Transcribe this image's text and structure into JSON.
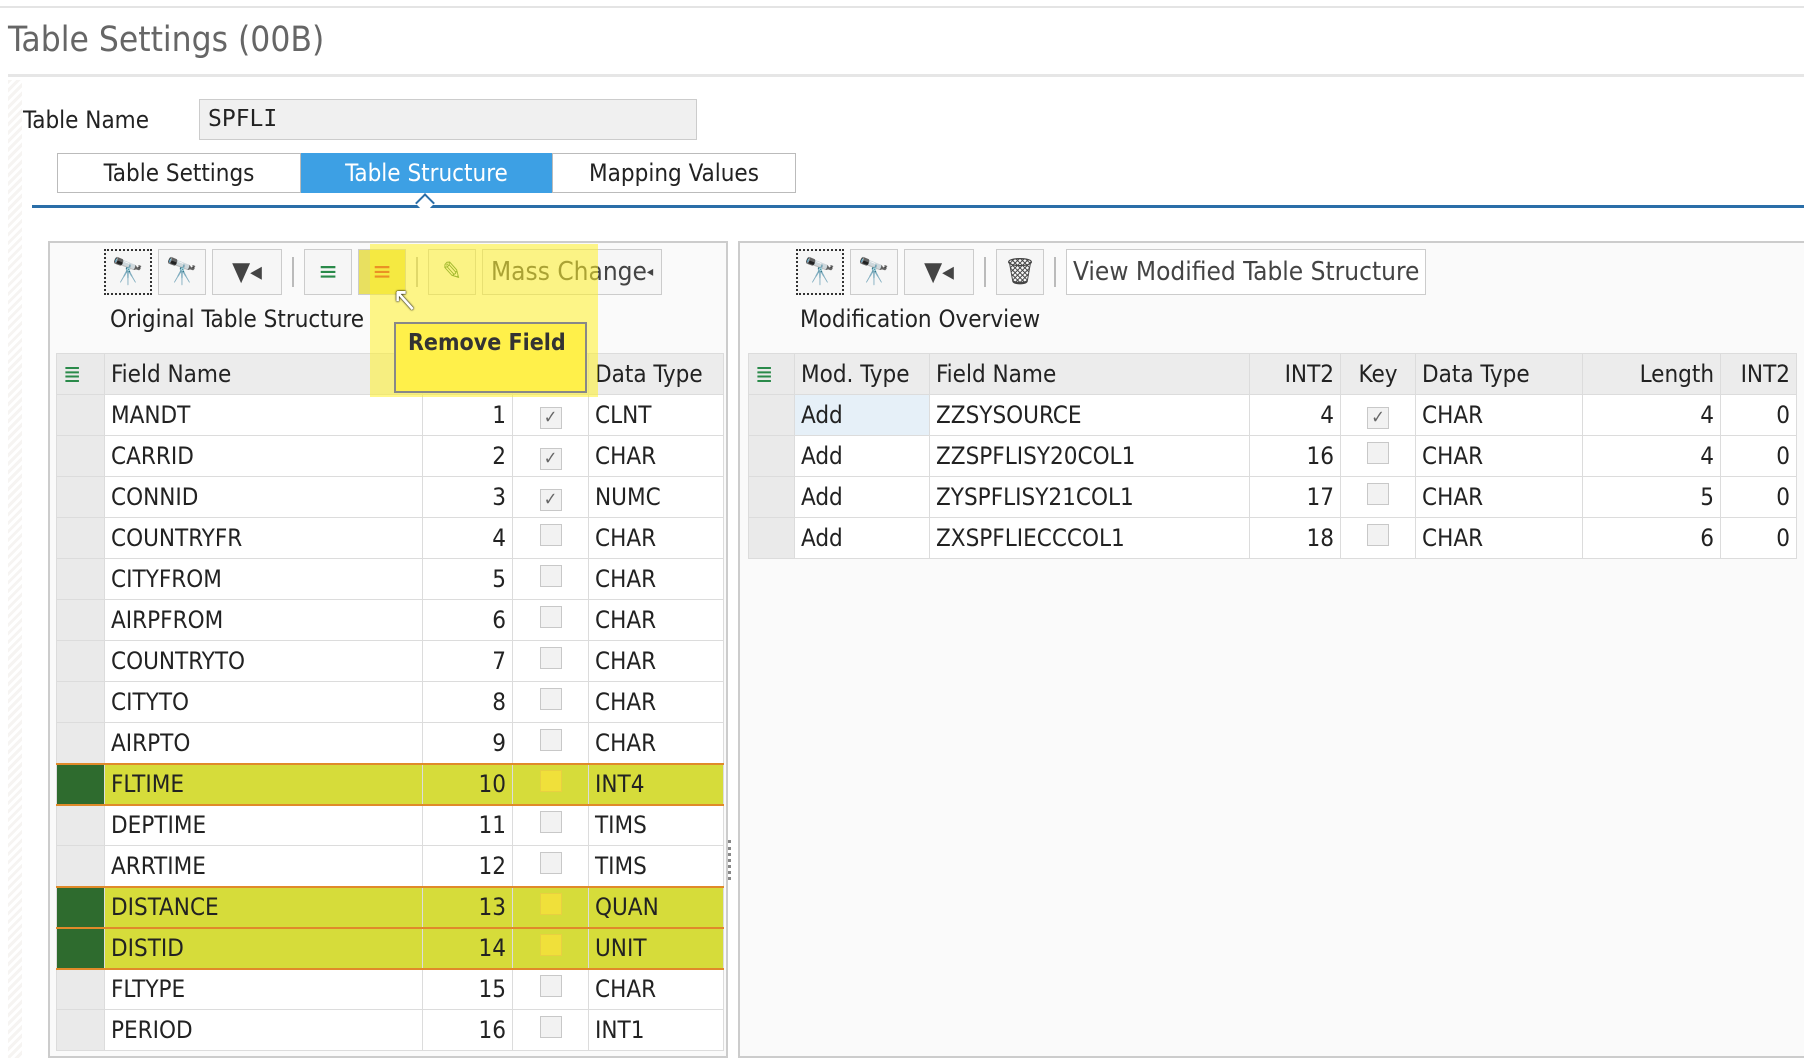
{
  "window": {
    "title": "Table Settings (00B)"
  },
  "table_name": {
    "label": "Table Name",
    "value": "SPFLI"
  },
  "tabs": [
    {
      "label": "Table Settings",
      "active": false
    },
    {
      "label": "Table Structure",
      "active": true
    },
    {
      "label": "Mapping Values",
      "active": false
    }
  ],
  "left": {
    "toolbar": {
      "find_icon": "binoculars-icon",
      "find_next_icon": "binoculars-plus-icon",
      "filter_icon": "filter-icon",
      "add_field_icon": "add-field-icon",
      "remove_field_icon": "remove-field-icon",
      "edit_icon": "pencil-icon",
      "mass_change": "Mass Change"
    },
    "title": "Original Table Structure",
    "tooltip": "Remove Field",
    "columns": [
      "Field Name",
      "",
      "",
      "Data Type"
    ],
    "rows": [
      {
        "name": "MANDT",
        "pos": "1",
        "key": true,
        "type": "CLNT"
      },
      {
        "name": "CARRID",
        "pos": "2",
        "key": true,
        "type": "CHAR"
      },
      {
        "name": "CONNID",
        "pos": "3",
        "key": true,
        "type": "NUMC"
      },
      {
        "name": "COUNTRYFR",
        "pos": "4",
        "key": false,
        "type": "CHAR"
      },
      {
        "name": "CITYFROM",
        "pos": "5",
        "key": false,
        "type": "CHAR"
      },
      {
        "name": "AIRPFROM",
        "pos": "6",
        "key": false,
        "type": "CHAR"
      },
      {
        "name": "COUNTRYTO",
        "pos": "7",
        "key": false,
        "type": "CHAR"
      },
      {
        "name": "CITYTO",
        "pos": "8",
        "key": false,
        "type": "CHAR"
      },
      {
        "name": "AIRPTO",
        "pos": "9",
        "key": false,
        "type": "CHAR"
      },
      {
        "name": "FLTIME",
        "pos": "10",
        "key": false,
        "type": "INT4",
        "selected": true
      },
      {
        "name": "DEPTIME",
        "pos": "11",
        "key": false,
        "type": "TIMS"
      },
      {
        "name": "ARRTIME",
        "pos": "12",
        "key": false,
        "type": "TIMS"
      },
      {
        "name": "DISTANCE",
        "pos": "13",
        "key": false,
        "type": "QUAN",
        "selected": true
      },
      {
        "name": "DISTID",
        "pos": "14",
        "key": false,
        "type": "UNIT",
        "selected": true
      },
      {
        "name": "FLTYPE",
        "pos": "15",
        "key": false,
        "type": "CHAR"
      },
      {
        "name": "PERIOD",
        "pos": "16",
        "key": false,
        "type": "INT1"
      }
    ]
  },
  "right": {
    "toolbar": {
      "find_icon": "binoculars-icon",
      "find_next_icon": "binoculars-plus-icon",
      "filter_icon": "filter-icon",
      "delete_icon": "trash-icon",
      "view_button": "View Modified Table Structure"
    },
    "title": "Modification Overview",
    "columns": [
      "Mod. Type",
      "Field Name",
      "INT2",
      "Key",
      "Data Type",
      "Length",
      "INT2"
    ],
    "rows": [
      {
        "mod": "Add",
        "name": "ZZSYSOURCE",
        "int2": "4",
        "key": true,
        "type": "CHAR",
        "length": "4",
        "int2b": "0"
      },
      {
        "mod": "Add",
        "name": "ZZSPFLISY20COL1",
        "int2": "16",
        "key": false,
        "type": "CHAR",
        "length": "4",
        "int2b": "0"
      },
      {
        "mod": "Add",
        "name": "ZYSPFLISY21COL1",
        "int2": "17",
        "key": false,
        "type": "CHAR",
        "length": "5",
        "int2b": "0"
      },
      {
        "mod": "Add",
        "name": "ZXSPFLIECCCOL1",
        "int2": "18",
        "key": false,
        "type": "CHAR",
        "length": "6",
        "int2b": "0"
      }
    ]
  },
  "colors": {
    "accent": "#3da0e4",
    "highlight": "#d6dc3a",
    "selected_marker": "#2e6b2e"
  }
}
